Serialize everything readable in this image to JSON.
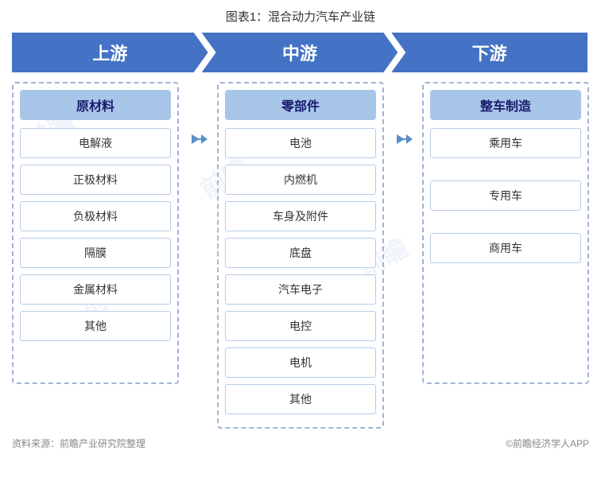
{
  "title": "图表1：混合动力汽车产业链",
  "banner": {
    "upstream": "上游",
    "midstream": "中游",
    "downstream": "下游"
  },
  "columns": {
    "upstream": {
      "header": "原材料",
      "items": [
        "电解液",
        "正极材料",
        "负极材料",
        "隔膜",
        "金属材料",
        "其他"
      ]
    },
    "midstream": {
      "header": "零部件",
      "items": [
        "电池",
        "内燃机",
        "车身及附件",
        "底盘",
        "汽车电子",
        "电控",
        "电机",
        "其他"
      ]
    },
    "downstream": {
      "header": "整车制造",
      "items": [
        "乘用车",
        "专用车",
        "商用车"
      ]
    }
  },
  "footer": {
    "source": "资料来源：前瞻产业研究院整理",
    "copyright": "©前瞻经济学人APP"
  }
}
